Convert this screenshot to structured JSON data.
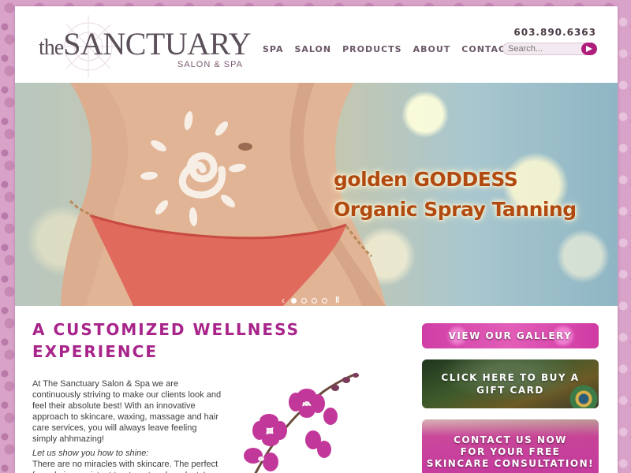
{
  "header": {
    "logo_the": "the",
    "logo_name": "SANCTUARY",
    "logo_sub": "SALON & SPA",
    "phone": "603.890.6363",
    "search_placeholder": "Search...",
    "nav": [
      {
        "label": "SPA"
      },
      {
        "label": "SALON"
      },
      {
        "label": "PRODUCTS"
      },
      {
        "label": "ABOUT"
      },
      {
        "label": "CONTACT"
      }
    ]
  },
  "hero": {
    "title_line1": "golden GODDESS",
    "title_line2": "Organic Spray Tanning",
    "slide_count": 4,
    "active_slide": 1
  },
  "main": {
    "heading_line1": "A CUSTOMIZED WELLNESS",
    "heading_line2": "EXPERIENCE",
    "paragraph1": "At The Sanctuary Salon & Spa we are continuously striving to make our clients look and feel their absolute best! With an innovative approach to skincare, waxing, massage and hair care services, you will always leave feeling simply ahhmazing!",
    "tagline": "Let us show you how to shine:",
    "paragraph2": "There are no miracles with skincare. The perfect formula is consistent treatment and products!"
  },
  "sidebar": {
    "gallery": "VIEW OUR GALLERY",
    "gift_line1": "CLICK HERE TO BUY A",
    "gift_line2": "GIFT CARD",
    "contact_line1": "CONTACT US NOW",
    "contact_line2": "FOR YOUR",
    "contact_free": "FREE",
    "contact_line3": "SKINCARE CONSULTATION!"
  },
  "colors": {
    "accent": "#a8248a",
    "hero_title": "#b04a10",
    "search_button": "#b01e7c"
  },
  "icons": {
    "search": "arrow-right-icon",
    "prev": "chevron-left-icon",
    "pause": "pause-icon"
  }
}
